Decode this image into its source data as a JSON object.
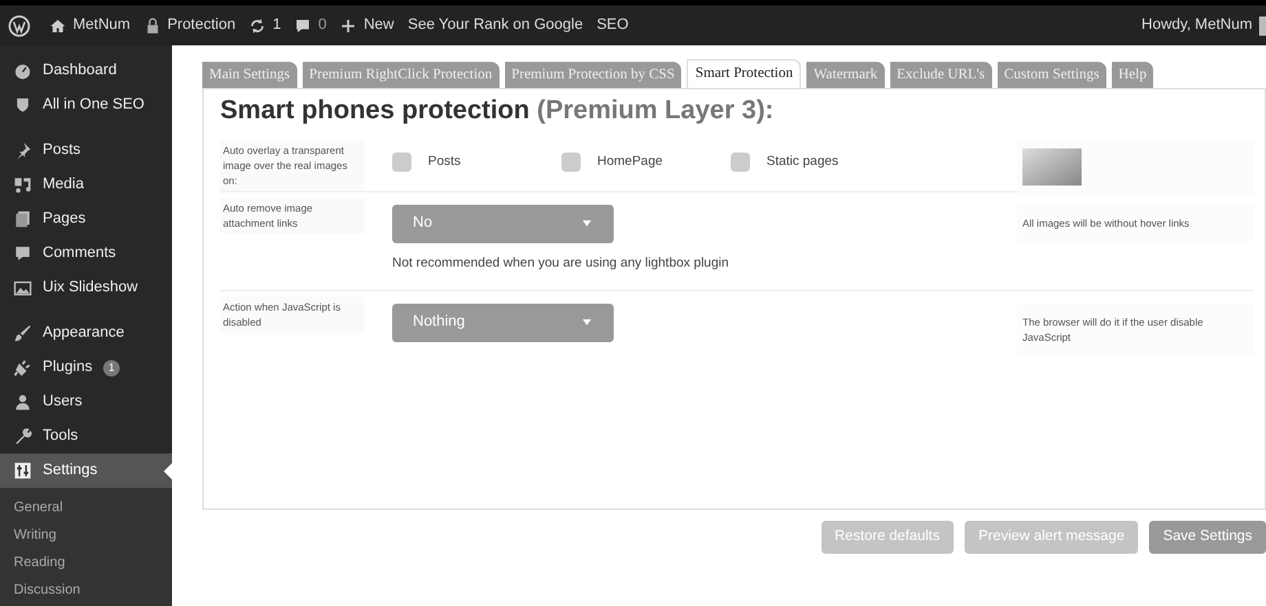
{
  "admin_bar": {
    "site": "MetNum",
    "items": [
      {
        "kind": "lock",
        "label": "Protection"
      },
      {
        "kind": "updates",
        "label": "1"
      },
      {
        "kind": "comments",
        "label": "0"
      },
      {
        "kind": "new",
        "label": "New"
      },
      {
        "kind": "text",
        "label": "See Your Rank on Google"
      },
      {
        "kind": "text",
        "label": "SEO"
      }
    ],
    "greeting": "Howdy, MetNum"
  },
  "sidebar": {
    "groups": [
      [
        {
          "kind": "dashboard",
          "label": "Dashboard",
          "selected": false
        },
        {
          "kind": "shield",
          "label": "All in One SEO",
          "selected": false
        }
      ],
      [
        {
          "kind": "pin",
          "label": "Posts",
          "selected": false
        },
        {
          "kind": "media",
          "label": "Media",
          "selected": false
        },
        {
          "kind": "pages",
          "label": "Pages",
          "selected": false
        },
        {
          "kind": "comment",
          "label": "Comments",
          "selected": false
        },
        {
          "kind": "slides",
          "label": "Uix Slideshow",
          "selected": false
        }
      ],
      [
        {
          "kind": "brush",
          "label": "Appearance",
          "selected": false
        },
        {
          "kind": "plug",
          "label": "Plugins",
          "badge": "1",
          "selected": false
        },
        {
          "kind": "user",
          "label": "Users",
          "selected": false
        },
        {
          "kind": "wrench",
          "label": "Tools",
          "selected": false
        },
        {
          "kind": "settings",
          "label": "Settings",
          "selected": true
        }
      ]
    ],
    "submenu": [
      "General",
      "Writing",
      "Reading",
      "Discussion"
    ]
  },
  "tabs": [
    {
      "label": "Main Settings",
      "selected": false
    },
    {
      "label": "Premium RightClick Protection",
      "selected": false
    },
    {
      "label": "Premium Protection by CSS",
      "selected": false
    },
    {
      "label": "Smart Protection",
      "selected": true
    },
    {
      "label": "Watermark",
      "selected": false
    },
    {
      "label": "Exclude URL's",
      "selected": false
    },
    {
      "label": "Custom Settings",
      "selected": false
    },
    {
      "label": "Help",
      "selected": false
    }
  ],
  "heading": {
    "title": "Smart phones protection",
    "highlight": "(Premium Layer 3):"
  },
  "rows": [
    {
      "kind": "checkboxes",
      "label": "Auto overlay a transparent image over the real images on:",
      "options": [
        {
          "label": "Posts",
          "checked": false
        },
        {
          "label": "HomePage",
          "checked": false
        },
        {
          "label": "Static pages",
          "checked": false
        }
      ]
    },
    {
      "kind": "select",
      "label": "Auto remove image attachment links",
      "value": "No",
      "note": "Not recommended when you are using any lightbox plugin",
      "aside": "All images will be without hover links"
    },
    {
      "kind": "select",
      "label": "Action when JavaScript is disabled",
      "value": "Nothing",
      "aside": "The browser will do it if the user disable JavaScript"
    }
  ],
  "buttons": [
    {
      "label": "Restore defaults",
      "kind": "secondary"
    },
    {
      "label": "Preview alert message",
      "kind": "secondary"
    },
    {
      "label": "Save Settings",
      "kind": "primary"
    }
  ]
}
